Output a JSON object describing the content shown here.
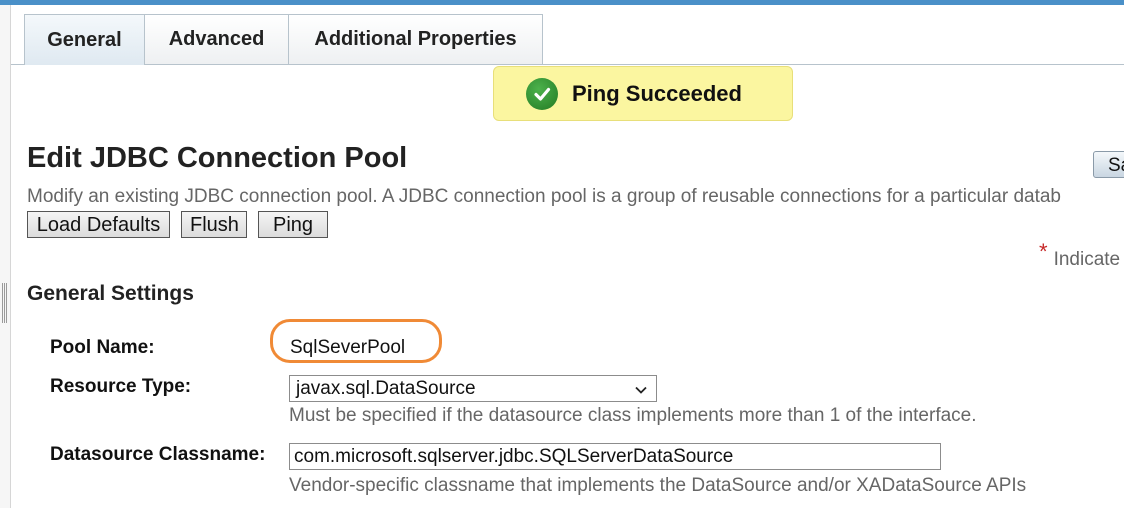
{
  "tabs": [
    {
      "label": "General",
      "active": true
    },
    {
      "label": "Advanced",
      "active": false
    },
    {
      "label": "Additional Properties",
      "active": false
    }
  ],
  "notification": {
    "text": "Ping Succeeded",
    "icon": "check-circle-icon",
    "color": "#2e8b2e",
    "background": "#fbf6a0"
  },
  "page": {
    "title": "Edit JDBC Connection Pool",
    "description": "Modify an existing JDBC connection pool. A JDBC connection pool is a group of reusable connections for a particular datab",
    "save_label": "Sa",
    "required_indicator": "Indicate"
  },
  "actions": {
    "load_defaults": "Load Defaults",
    "flush": "Flush",
    "ping": "Ping"
  },
  "general_settings": {
    "title": "General Settings",
    "pool_name": {
      "label": "Pool Name:",
      "value": "SqlSeverPool"
    },
    "resource_type": {
      "label": "Resource Type:",
      "value": "javax.sql.DataSource",
      "help": "Must be specified if the datasource class implements more than 1 of the interface."
    },
    "datasource_classname": {
      "label": "Datasource Classname:",
      "value": "com.microsoft.sqlserver.jdbc.SQLServerDataSource",
      "help": "Vendor-specific classname that implements the DataSource and/or XADataSource APIs"
    }
  },
  "colors": {
    "highlight": "#f08a36",
    "accent": "#4a90c8"
  }
}
